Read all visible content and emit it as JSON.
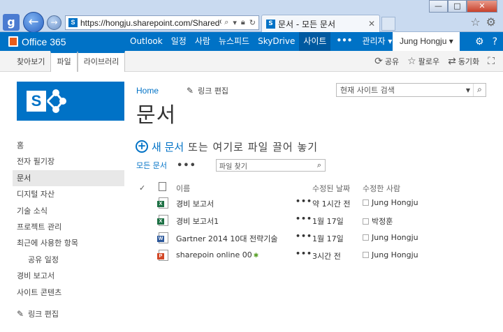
{
  "browser": {
    "address_url": "https://hongju.sharepoint.com/Shared%2C",
    "tab_title": "문서 - 모든 문서",
    "tab_close": "✕",
    "win_min": "—",
    "win_max": "□",
    "win_close": "✕"
  },
  "suite": {
    "brand": "Office 365",
    "links": [
      "Outlook",
      "일정",
      "사람",
      "뉴스피드",
      "SkyDrive",
      "사이트"
    ],
    "active_link": "사이트",
    "more": "•••",
    "admin": "관리자 ▾",
    "user": "Jung Hongju ▾",
    "icons": [
      "gear-icon",
      "help-icon"
    ]
  },
  "ribbon": {
    "tabs": [
      "찾아보기",
      "파일",
      "라이브러리"
    ],
    "actions": [
      {
        "icon": "share-icon",
        "label": "공유"
      },
      {
        "icon": "star-icon",
        "label": "팔로우"
      },
      {
        "icon": "sync-icon",
        "label": "동기화"
      }
    ]
  },
  "page": {
    "breadcrumb_home": "Home",
    "edit_links": "링크 편집",
    "site_search_placeholder": "현재 사이트 검색",
    "title": "문서",
    "new_doc_blue": "새 문서",
    "new_doc_rest": "또는 여기로 파일 끌어 놓기",
    "view_all": "모든 문서",
    "view_more": "•••",
    "file_search_placeholder": "파일 찾기"
  },
  "leftnav": {
    "items": [
      {
        "label": "홈"
      },
      {
        "label": "전자 필기장"
      },
      {
        "label": "문서"
      },
      {
        "label": "디지털 자산"
      },
      {
        "label": "기술 소식"
      },
      {
        "label": "프로젝트 관리"
      },
      {
        "label": "최근에 사용한 항목"
      },
      {
        "label": "공유 일정"
      },
      {
        "label": "경비 보고서"
      },
      {
        "label": "사이트 콘텐츠"
      }
    ],
    "edit_links": "링크 편집"
  },
  "doclist": {
    "headers": {
      "name": "이름",
      "modified": "수정된 날짜",
      "modified_by": "수정한 사람"
    },
    "rows": [
      {
        "type": "excel",
        "name": "경비 보고서",
        "dots": "•••",
        "modified": "약 1시간 전",
        "by": "Jung Hongju",
        "new": ""
      },
      {
        "type": "excel",
        "name": "경비 보고서1",
        "dots": "•••",
        "modified": "1월 17일",
        "by": "박정훈",
        "new": ""
      },
      {
        "type": "word",
        "name": "Gartner 2014 10대 전략기술",
        "dots": "•••",
        "modified": "1월 17일",
        "by": "Jung Hongju",
        "new": ""
      },
      {
        "type": "powerpoint",
        "name": "sharepoin online 00",
        "dots": "•••",
        "modified": "3시간 전",
        "by": "Jung Hongju",
        "new": "✱"
      }
    ]
  },
  "colors": {
    "brand_blue": "#0072c6",
    "excel": "#1e7145",
    "word": "#2b579a",
    "powerpoint": "#d24726"
  }
}
